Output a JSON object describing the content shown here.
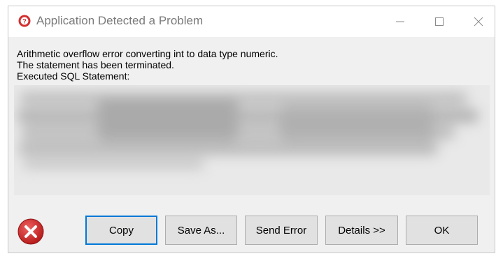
{
  "window": {
    "title": "Application Detected a Problem"
  },
  "message": {
    "line1": "Arithmetic overflow error converting int to data type numeric.",
    "line2": "The statement has been terminated.",
    "line3": "Executed SQL Statement:"
  },
  "buttons": {
    "copy": "Copy",
    "save_as": "Save As...",
    "send_error": "Send Error",
    "details": "Details >>",
    "ok": "OK"
  },
  "icons": {
    "app": "help-error-icon",
    "error": "error-x-icon",
    "minimize": "minimize-icon",
    "maximize": "maximize-icon",
    "close": "close-icon"
  },
  "colors": {
    "accent": "#0078d7",
    "error_red": "#d32f2f",
    "title_text": "#7a7a7a",
    "dialog_bg": "#f0f0f0"
  }
}
